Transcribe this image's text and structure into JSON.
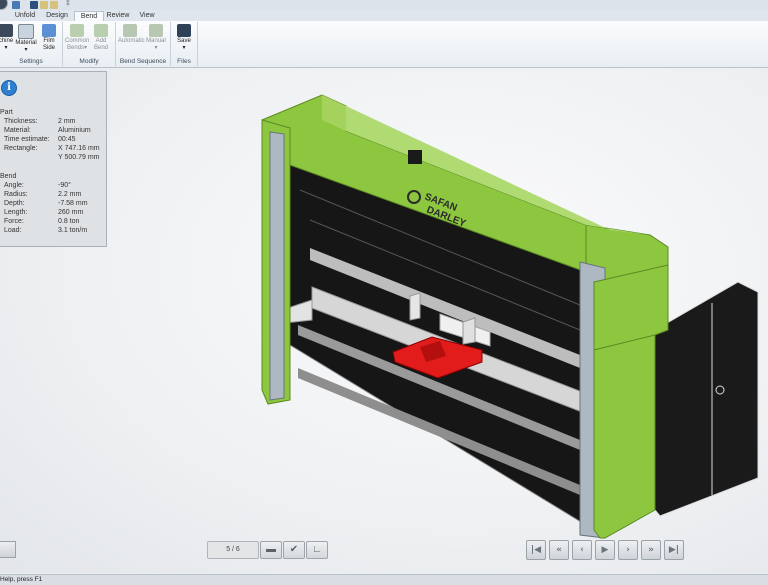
{
  "quick_access": {
    "title_fragment": "‡"
  },
  "tabs": [
    {
      "label": "Unfold"
    },
    {
      "label": "Design"
    },
    {
      "label": "Bend"
    },
    {
      "label": "Review"
    },
    {
      "label": "View"
    }
  ],
  "ribbon": {
    "settings": {
      "label": "Settings",
      "machine": "chine",
      "material": "Material",
      "film_side": "Film Side"
    },
    "modify": {
      "label": "Modify",
      "common_bends": "Common Bends",
      "add_bend": "Add Bend"
    },
    "bend_sequence": {
      "label": "Bend Sequence",
      "automatic": "Automatic",
      "manual": "Manual"
    },
    "files": {
      "label": "Files",
      "save": "Save"
    }
  },
  "info": {
    "part_title": "Part",
    "part": [
      {
        "key": "Thickness:",
        "value": "2 mm"
      },
      {
        "key": "Material:",
        "value": "Aluminium"
      },
      {
        "key": "Time estimate:",
        "value": "00:45"
      },
      {
        "key": "Rectangle:",
        "value": "X 747.16 mm"
      },
      {
        "key": "",
        "value": "Y 500.79 mm"
      }
    ],
    "bend_title": "Bend",
    "bend": [
      {
        "key": "Angle:",
        "value": "-90°"
      },
      {
        "key": "Radius:",
        "value": "2.2 mm"
      },
      {
        "key": "Depth:",
        "value": "-7.58 mm"
      },
      {
        "key": "Length:",
        "value": "260 mm"
      },
      {
        "key": "Force:",
        "value": "0.8 ton"
      },
      {
        "key": "Load:",
        "value": "3.1 ton/m"
      }
    ]
  },
  "machine_brand": {
    "line1": "SAFAN",
    "line2": "DARLEY"
  },
  "pager": {
    "text": "5 / 6"
  },
  "status": {
    "text": "Help, press F1"
  },
  "colors": {
    "machine_green": "#8dc63f",
    "part_red": "#e21b1b",
    "info_blue": "#2f7fd0"
  },
  "icons": [
    "info-icon",
    "save-icon",
    "undo-icon",
    "redo-icon",
    "checkmark-icon",
    "first-icon",
    "prev-prev-icon",
    "prev-icon",
    "play-icon",
    "next-icon",
    "next-next-icon",
    "last-icon"
  ]
}
